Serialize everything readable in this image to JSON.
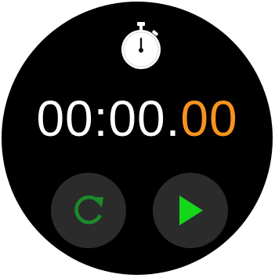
{
  "timer": {
    "main": "00:00.",
    "hundredths": "00"
  },
  "icons": {
    "header": "stopwatch-icon",
    "reset": "reset-icon",
    "start": "play-icon"
  },
  "colors": {
    "background": "#000000",
    "time_main": "#ffffff",
    "time_hundredths": "#f7931e",
    "button_background": "#2b2b2b",
    "reset_icon": "#1b8a2a",
    "play_icon": "#14d61b"
  }
}
